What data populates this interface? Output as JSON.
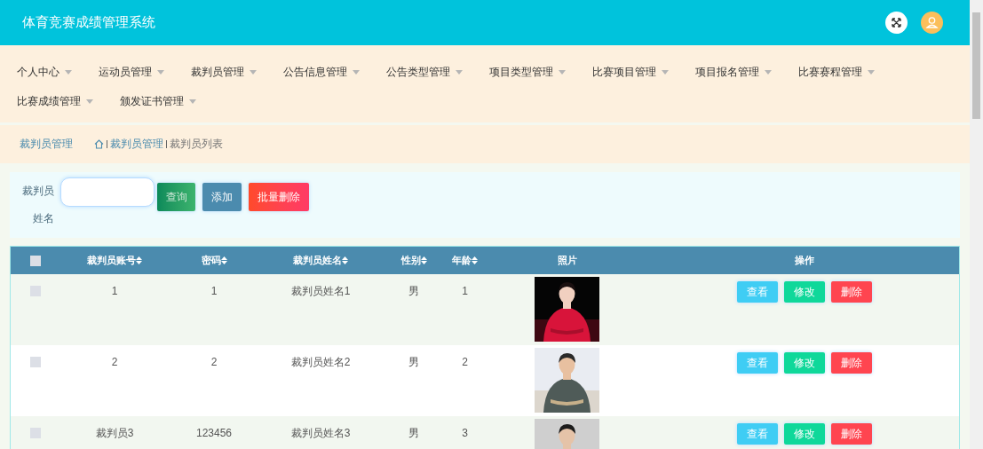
{
  "header": {
    "title": "体育竞赛成绩管理系统"
  },
  "nav": [
    {
      "label": "个人中心"
    },
    {
      "label": "运动员管理"
    },
    {
      "label": "裁判员管理"
    },
    {
      "label": "公告信息管理"
    },
    {
      "label": "公告类型管理"
    },
    {
      "label": "项目类型管理"
    },
    {
      "label": "比赛项目管理"
    },
    {
      "label": "项目报名管理"
    },
    {
      "label": "比赛赛程管理"
    },
    {
      "label": "比赛成绩管理"
    },
    {
      "label": "颁发证书管理"
    }
  ],
  "breadcrumb": {
    "title": "裁判员管理",
    "path": [
      "裁判员管理",
      "裁判员列表"
    ]
  },
  "search": {
    "label": "裁判员姓名",
    "buttons": [
      {
        "label": "查询",
        "kind": "search"
      },
      {
        "label": "添加",
        "kind": "add"
      },
      {
        "label": "批量删除",
        "kind": "delete"
      }
    ]
  },
  "table": {
    "select_all": {
      "checked": false
    },
    "columns": [
      {
        "label": "裁判员账号",
        "sortable": true
      },
      {
        "label": "密码",
        "sortable": true
      },
      {
        "label": "裁判员姓名",
        "sortable": true
      },
      {
        "label": "性别",
        "sortable": true
      },
      {
        "label": "年龄",
        "sortable": true
      },
      {
        "label": "照片",
        "sortable": false
      },
      {
        "label": "操作",
        "sortable": false
      }
    ],
    "rows": [
      {
        "checked": false,
        "cells": [
          "1",
          "1",
          "裁判员姓名1",
          "男",
          "1"
        ],
        "actions": [
          {
            "label": "查看",
            "kind": "view"
          },
          {
            "label": "修改",
            "kind": "edit"
          },
          {
            "label": "删除",
            "kind": "delete"
          }
        ]
      },
      {
        "checked": false,
        "cells": [
          "2",
          "2",
          "裁判员姓名2",
          "男",
          "2"
        ],
        "actions": [
          {
            "label": "查看",
            "kind": "view"
          },
          {
            "label": "修改",
            "kind": "edit"
          },
          {
            "label": "删除",
            "kind": "delete"
          }
        ]
      },
      {
        "checked": false,
        "cells": [
          "裁判员3",
          "123456",
          "裁判员姓名3",
          "男",
          "3"
        ],
        "actions": [
          {
            "label": "查看",
            "kind": "view"
          },
          {
            "label": "修改",
            "kind": "edit"
          },
          {
            "label": "删除",
            "kind": "delete"
          }
        ]
      }
    ]
  }
}
